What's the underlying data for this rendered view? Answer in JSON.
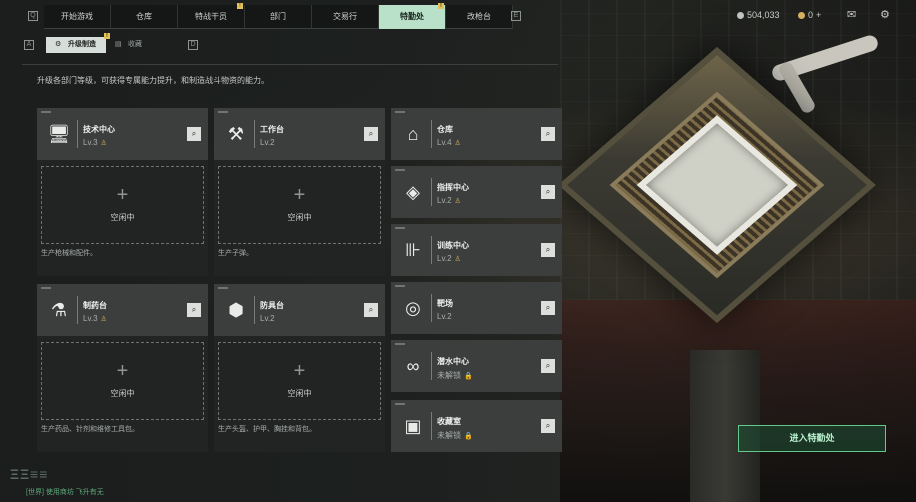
{
  "nav": {
    "tabs": [
      {
        "label": "开始游戏",
        "badge": ""
      },
      {
        "label": "仓库",
        "badge": ""
      },
      {
        "label": "特战干员",
        "badge": "!"
      },
      {
        "label": "部门",
        "badge": ""
      },
      {
        "label": "交易行",
        "badge": ""
      },
      {
        "label": "特勤处",
        "badge": "!",
        "active": true
      },
      {
        "label": "改枪台",
        "badge": ""
      }
    ],
    "prev_key": "Q",
    "next_key": "E"
  },
  "currency": {
    "silver": "504,033",
    "gold": "0",
    "gold_add": "+"
  },
  "subtabs": {
    "prev_key": "A",
    "next_key": "D",
    "items": [
      {
        "label": "升级制造",
        "badge": "!"
      },
      {
        "label": "收藏"
      }
    ]
  },
  "description": "升级各部门等级，可获得专属能力提升，和制造战斗物资的能力。",
  "production_cards": [
    {
      "name": "技术中心",
      "level": "Lv.3",
      "icon": "monitor-icon",
      "glyph": "🖥",
      "slot_label": "空闲中",
      "footer": "生产枪械和配件。"
    },
    {
      "name": "工作台",
      "level": "Lv.2",
      "icon": "tools-icon",
      "glyph": "⚒",
      "slot_label": "空闲中",
      "footer": "生产子弹。"
    },
    {
      "name": "制药台",
      "level": "Lv.3",
      "icon": "microscope-icon",
      "glyph": "⚗",
      "slot_label": "空闲中",
      "footer": "生产药品、针剂和维修工具包。"
    },
    {
      "name": "防具台",
      "level": "Lv.2",
      "icon": "armor-boxes-icon",
      "glyph": "⬢",
      "slot_label": "空闲中",
      "footer": "生产头盔、护甲、胸挂和背包。"
    }
  ],
  "facility_cards": [
    {
      "name": "仓库",
      "level": "Lv.4",
      "icon": "warehouse-icon",
      "glyph": "⌂",
      "locked": false
    },
    {
      "name": "指挥中心",
      "level": "Lv.2",
      "icon": "command-icon",
      "glyph": "◈",
      "locked": false
    },
    {
      "name": "训练中心",
      "level": "Lv.2",
      "icon": "dumbbell-icon",
      "glyph": "⊪",
      "locked": false
    },
    {
      "name": "靶场",
      "level": "Lv.2",
      "icon": "target-icon",
      "glyph": "◎",
      "locked": false
    },
    {
      "name": "潜水中心",
      "level": "未解锁",
      "icon": "diving-goggles-icon",
      "glyph": "∞",
      "locked": true
    },
    {
      "name": "收藏室",
      "level": "未解锁",
      "icon": "display-case-icon",
      "glyph": "▣",
      "locked": true
    }
  ],
  "enter_button": "进入特勤处",
  "bottom_logo": "ΞΞ≡≡",
  "bottom_text": "[世界] 使用商坊   飞升有无",
  "colors": {
    "accent_green": "#b9e0c8",
    "enter_border": "#63c98a",
    "badge_yellow": "#e3c25c",
    "medal_gold": "#c9a85a"
  }
}
